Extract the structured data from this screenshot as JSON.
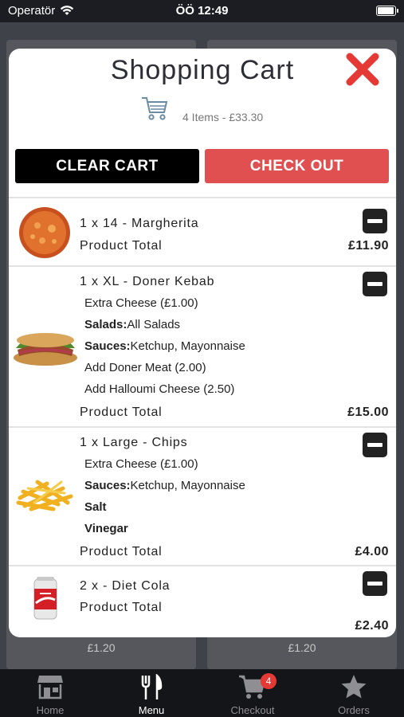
{
  "status": {
    "carrier": "Operatör",
    "time": "ÖÖ 12:49",
    "battery_percent": 95
  },
  "background": {
    "prices": [
      "£1.20",
      "£1.20"
    ]
  },
  "modal": {
    "title": "Shopping Cart",
    "summary": "4 Items - £33.30",
    "clear_label": "CLEAR CART",
    "checkout_label": "CHECK OUT"
  },
  "items": [
    {
      "title": "1 x 14 - Margherita",
      "options": [],
      "total_label": "Product Total",
      "total": "£11.90",
      "image": "pizza-image"
    },
    {
      "title": "1 x XL - Doner Kebab",
      "options": [
        {
          "key": "",
          "value": "Extra Cheese (£1.00)"
        },
        {
          "key": "Salads:",
          "value": "All Salads"
        },
        {
          "key": "Sauces:",
          "value": "Ketchup, Mayonnaise"
        },
        {
          "key": "",
          "value": "Add Doner Meat (2.00)"
        },
        {
          "key": "",
          "value": "Add Halloumi Cheese (2.50)"
        }
      ],
      "total_label": "Product Total",
      "total": "£15.00",
      "image": "kebab-image"
    },
    {
      "title": "1 x Large - Chips",
      "options": [
        {
          "key": "",
          "value": "Extra Cheese (£1.00)"
        },
        {
          "key": "Sauces:",
          "value": "Ketchup, Mayonnaise"
        },
        {
          "key": "Salt",
          "value": ""
        },
        {
          "key": "Vinegar",
          "value": ""
        }
      ],
      "total_label": "Product Total",
      "total": "£4.00",
      "image": "chips-image"
    },
    {
      "title": "2 x - Diet Cola",
      "options": [],
      "total_label": "Product Total",
      "total": "£2.40",
      "image": "cola-can-image"
    }
  ],
  "tabs": [
    {
      "label": "Home",
      "icon": "store-icon",
      "active": false
    },
    {
      "label": "Menu",
      "icon": "fork-knife-icon",
      "active": true
    },
    {
      "label": "Checkout",
      "icon": "cart-icon",
      "active": false,
      "badge": "4"
    },
    {
      "label": "Orders",
      "icon": "star-icon",
      "active": false
    }
  ],
  "colors": {
    "accent": "#e05050",
    "close": "#e53935"
  }
}
